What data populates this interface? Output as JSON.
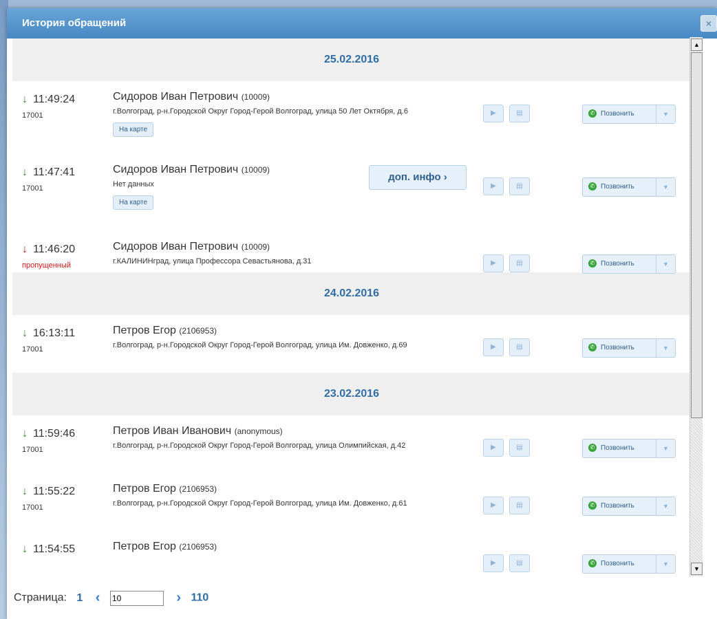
{
  "dialog": {
    "title": "История обращений",
    "close_icon": "×"
  },
  "groups": [
    {
      "date": "25.02.2016",
      "records": [
        {
          "time": "11:49:24",
          "direction": "in",
          "sub": "17001",
          "name": "Сидоров Иван Петрович",
          "id": "(10009)",
          "address": "г.Волгоград, р-н.Городской Округ Город-Герой Волгоград, улица 50 Лет Октября, д.6",
          "map": "На карте",
          "dop": ""
        },
        {
          "time": "11:47:41",
          "direction": "in",
          "sub": "17001",
          "name": "Сидоров Иван Петрович",
          "id": "(10009)",
          "address": "Нет данных",
          "map": "На карте",
          "dop": "доп. инфо ›"
        },
        {
          "time": "11:46:20",
          "direction": "missed",
          "sub": "пропущенный",
          "name": "Сидоров Иван Петрович",
          "id": "(10009)",
          "address": "г.КАЛИНИНград, улица Профессора Севастьянова, д.31",
          "map": "",
          "dop": ""
        }
      ]
    },
    {
      "date": "24.02.2016",
      "records": [
        {
          "time": "16:13:11",
          "direction": "in",
          "sub": "17001",
          "name": "Петров Егор",
          "id": "(2106953)",
          "address": "г.Волгоград, р-н.Городской Округ Город-Герой Волгоград, улица Им. Довженко, д.69",
          "map": "",
          "dop": ""
        }
      ]
    },
    {
      "date": "23.02.2016",
      "records": [
        {
          "time": "11:59:46",
          "direction": "in",
          "sub": "17001",
          "name": "Петров Иван Иванович",
          "id": "(anonymous)",
          "address": "г.Волгоград, р-н.Городской Округ Город-Герой Волгоград, улица Олимпийская, д.42",
          "map": "",
          "dop": ""
        },
        {
          "time": "11:55:22",
          "direction": "in",
          "sub": "17001",
          "name": "Петров Егор",
          "id": "(2106953)",
          "address": "г.Волгоград, р-н.Городской Округ Город-Герой Волгоград, улица Им. Довженко, д.61",
          "map": "",
          "dop": ""
        },
        {
          "time": "11:54:55",
          "direction": "in",
          "sub": "",
          "name": "Петров Егор",
          "id": "(2106953)",
          "address": "",
          "map": "",
          "dop": ""
        }
      ]
    }
  ],
  "buttons": {
    "call": "Позвонить",
    "play_icon": "▶",
    "record_icon": "▤",
    "dropdown_icon": "▼",
    "arrow_in": "↓",
    "arrow_missed": "↓"
  },
  "pager": {
    "label": "Страница:",
    "first": "1",
    "current": "10",
    "last": "110",
    "prev_icon": "‹",
    "next_icon": "›"
  },
  "colors": {
    "accent": "#2f6ea4",
    "titlebar": "#4888c4",
    "incoming": "#3a8a2a",
    "missed": "#c02020"
  }
}
